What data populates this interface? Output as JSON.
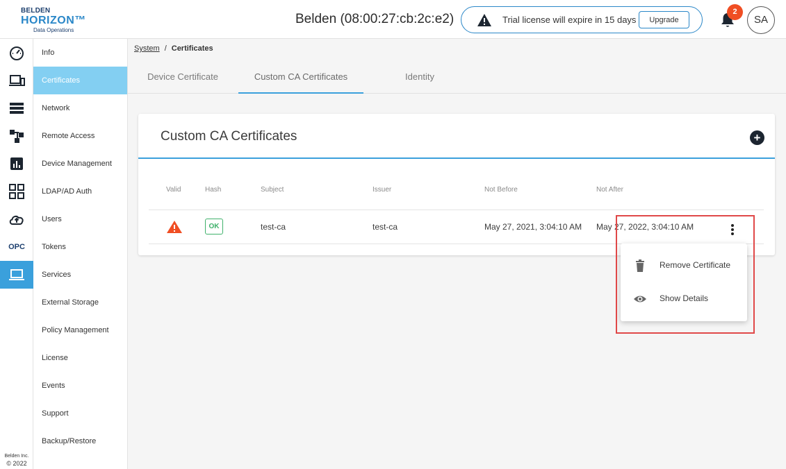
{
  "logo": {
    "line1": "BELDEN",
    "line2": "HORIZON™",
    "line3": "Data Operations"
  },
  "header": {
    "device_title": "Belden (08:00:27:cb:2c:e2)",
    "trial_text": "Trial license will expire in 15 days",
    "upgrade_label": "Upgrade",
    "notification_count": "2",
    "avatar_initials": "SA"
  },
  "rail": {
    "items": [
      "dashboard-icon",
      "devices-icon",
      "server-icon",
      "topology-icon",
      "analytics-icon",
      "apps-grid-icon",
      "cloud-upload-icon",
      "opc-icon",
      "system-laptop-icon"
    ],
    "opc_label": "OPC",
    "active_index": 8,
    "company": "Belden Inc.",
    "year": "© 2022"
  },
  "submenu": {
    "items": [
      {
        "label": "Info"
      },
      {
        "label": "Certificates"
      },
      {
        "label": "Network"
      },
      {
        "label": "Remote Access"
      },
      {
        "label": "Device Management"
      },
      {
        "label": "LDAP/AD Auth"
      },
      {
        "label": "Users"
      },
      {
        "label": "Tokens"
      },
      {
        "label": "Services"
      },
      {
        "label": "External Storage"
      },
      {
        "label": "Policy Management"
      },
      {
        "label": "License"
      },
      {
        "label": "Events"
      },
      {
        "label": "Support"
      },
      {
        "label": "Backup/Restore"
      }
    ],
    "active_index": 1
  },
  "breadcrumb": {
    "parent": "System",
    "separator": "/",
    "current": "Certificates"
  },
  "tabs": [
    {
      "label": "Device Certificate"
    },
    {
      "label": "Custom CA Certificates"
    },
    {
      "label": "Identity"
    }
  ],
  "active_tab": 1,
  "card": {
    "title": "Custom CA Certificates",
    "add_label": "+",
    "columns": [
      "Valid",
      "Hash",
      "Subject",
      "Issuer",
      "Not Before",
      "Not After"
    ],
    "rows": [
      {
        "valid_icon": "warning-triangle-icon",
        "hash": "OK",
        "subject": "test-ca",
        "issuer": "test-ca",
        "not_before": "May 27, 2021, 3:04:10 AM",
        "not_after": "May 27, 2022, 3:04:10 AM"
      }
    ]
  },
  "context_menu": {
    "items": [
      {
        "label": "Remove Certificate",
        "icon": "trash-icon"
      },
      {
        "label": "Show Details",
        "icon": "eye-icon"
      }
    ]
  },
  "colors": {
    "accent": "#3aa0dc",
    "active_submenu": "#83cff2",
    "warning": "#f04e23",
    "ok": "#3fb16b",
    "highlight": "#e04848"
  }
}
